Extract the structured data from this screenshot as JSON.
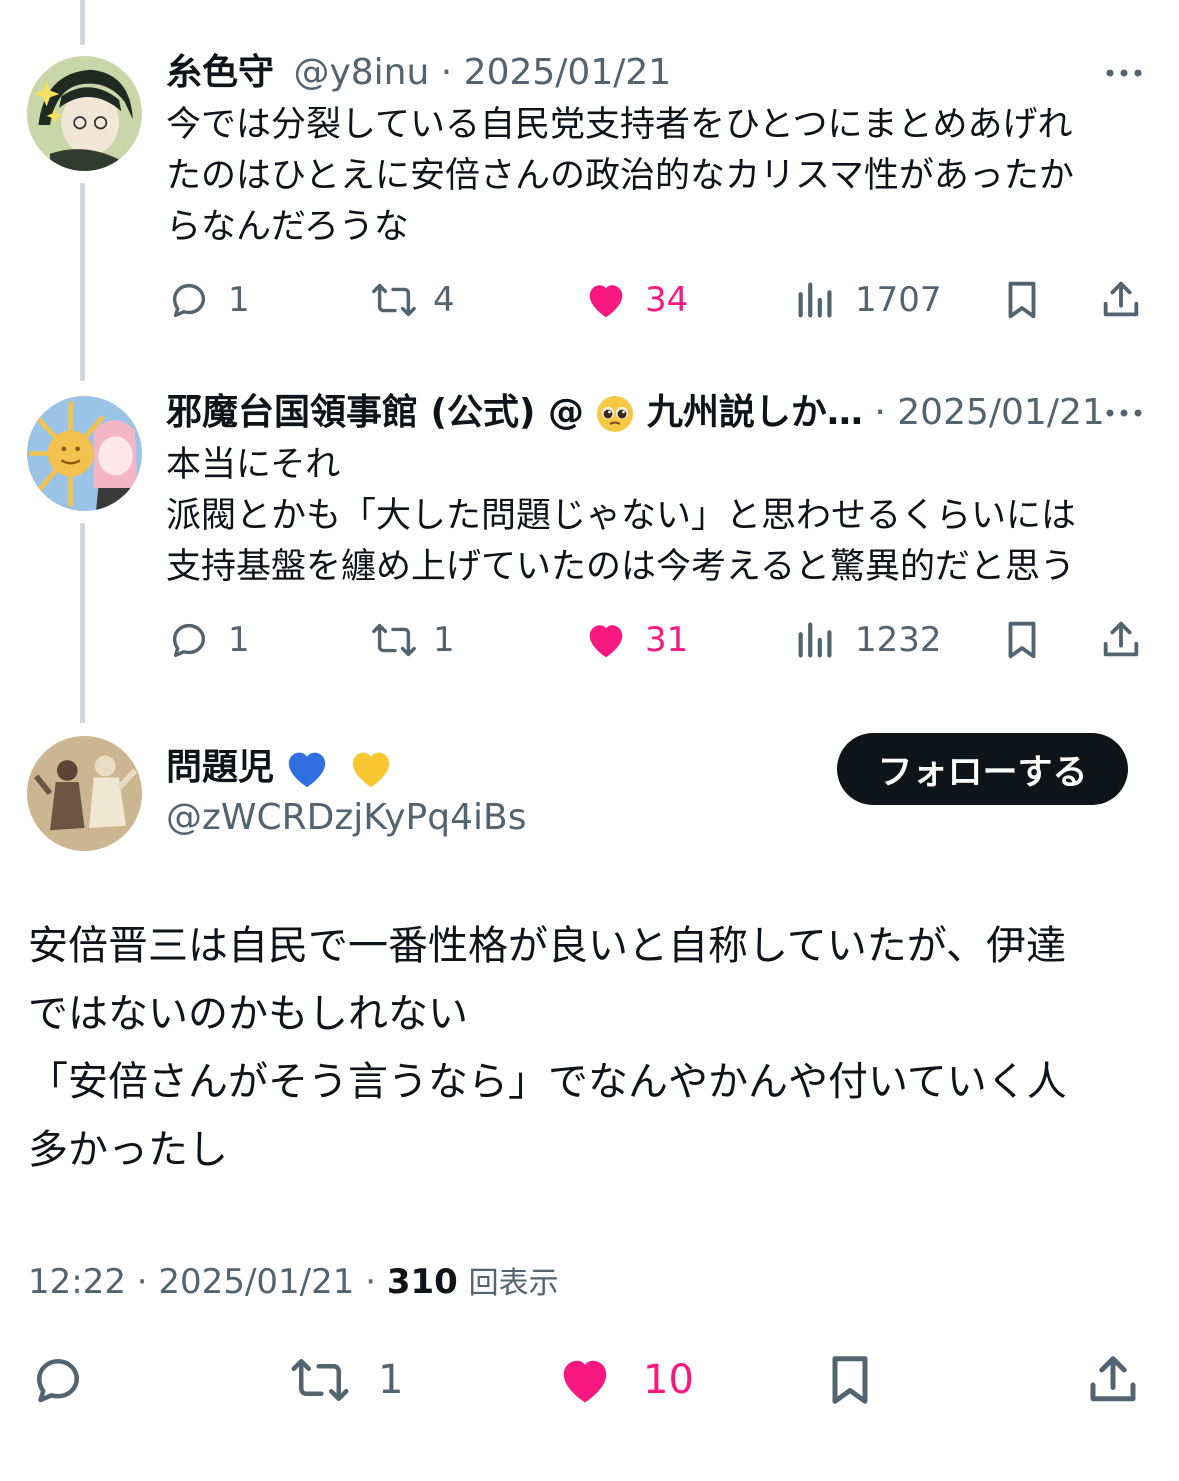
{
  "colors": {
    "text": "#0f1419",
    "muted": "#536471",
    "like": "#f91880",
    "thread_line": "#cfd9de",
    "follow_bg": "#0f1419"
  },
  "reply1": {
    "name": "糸色守",
    "handle": "@y8inu",
    "sep": "·",
    "date": "2025/01/21",
    "lines": [
      "今では分裂している自民党支持者をひとつにまとめあげれ",
      "たのはひとえに安倍さんの政治的なカリスマ性があったか",
      "らなんだろうな"
    ],
    "replies": "1",
    "reposts": "4",
    "likes": "34",
    "views": "1707"
  },
  "reply2": {
    "name": "邪魔台国領事館 (公式) @",
    "emoji": "pleading-face-emoji",
    "name_tail": "九州説しか…",
    "sep": "·",
    "date": "2025/01/21",
    "lines": [
      "本当にそれ",
      "派閥とかも「大した問題じゃない」と思わせるくらいには",
      "支持基盤を纏め上げていたのは今考えると驚異的だと思う"
    ],
    "replies": "1",
    "reposts": "1",
    "likes": "31",
    "views": "1232"
  },
  "main": {
    "name": "問題児",
    "heart_emojis": [
      "blue-heart",
      "yellow-heart"
    ],
    "handle": "@zWCRDzjKyPq4iBs",
    "follow_label": "フォローする",
    "lines": [
      "安倍晋三は自民で一番性格が良いと自称していたが、伊達",
      "ではないのかもしれない",
      "「安倍さんがそう言うなら」でなんやかんや付いていく人",
      "多かったし"
    ],
    "time": "12:22",
    "sep": "·",
    "date": "2025/01/21",
    "view_count": "310",
    "view_label": "回表示",
    "reposts": "1",
    "likes": "10"
  }
}
